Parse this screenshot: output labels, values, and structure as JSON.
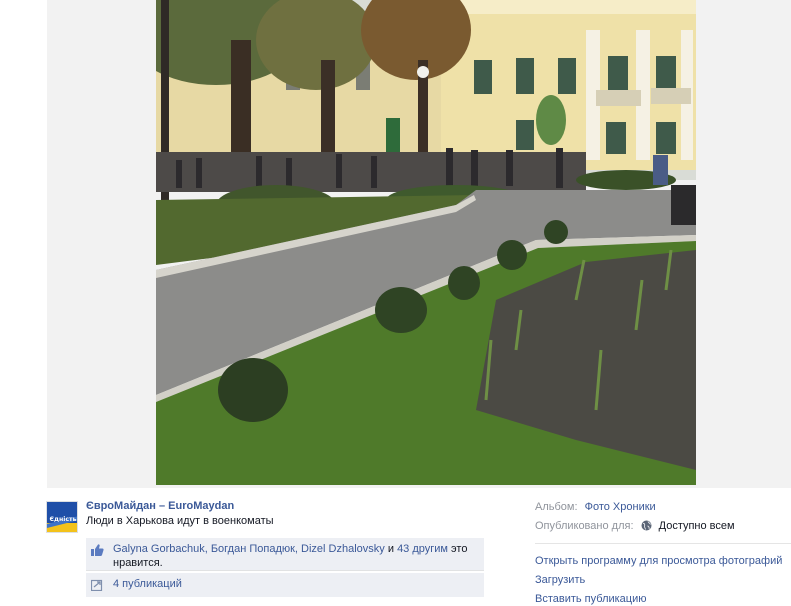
{
  "post": {
    "page_name": "ЄвроМайдан – EuroMaydan",
    "caption": "Люди в Харькова идут в военкоматы",
    "avatar_text": "Єдність"
  },
  "likes": {
    "names": "Galyna Gorbachuk, Богдан Попадюк, Dizel Dzhalovsky",
    "middle": " и ",
    "others": "43 другим",
    "suffix": " это нравится."
  },
  "shares": {
    "label": "4 публикаций"
  },
  "meta": {
    "album_label": "Альбом:",
    "album_value": "Фото Хроники",
    "published_label": "Опубликовано для:",
    "published_value": "Доступно всем"
  },
  "actions": {
    "open_viewer": "Открыть программу для просмотра фотографий",
    "download": "Загрузить",
    "embed": "Вставить публикацию"
  },
  "colors": {
    "link": "#3b5998",
    "muted": "#90949c",
    "box_bg": "#edeff4",
    "avatar_blue": "#1f4fa8",
    "avatar_yellow": "#f3c21b"
  },
  "icons": {
    "like": "thumbs-up-icon",
    "share": "share-icon",
    "audience": "globe-icon"
  }
}
